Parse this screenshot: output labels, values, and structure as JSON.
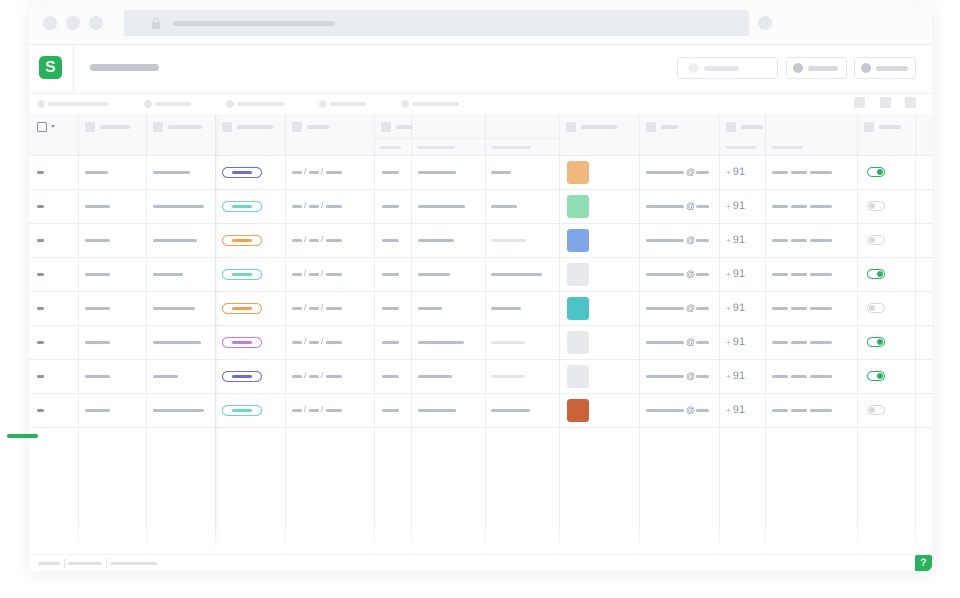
{
  "app": {
    "logo_glyph": "S",
    "logo_color": "#27b35c",
    "accent": "#27b35c"
  },
  "footer": {
    "help_label": "?"
  },
  "rows": [
    {
      "pill_color": "#6b6fd0",
      "swatch": "#f0b87c",
      "phone_prefix": "+",
      "phone_code": "91",
      "at": "@",
      "toggle": true,
      "link_light": false
    },
    {
      "pill_color": "#6fd6c4",
      "swatch": "#8fddb0",
      "phone_prefix": "+",
      "phone_code": "91",
      "at": "@",
      "toggle": false,
      "link_light": false
    },
    {
      "pill_color": "#f0a24e",
      "swatch": "#7fa6e8",
      "phone_prefix": "+",
      "phone_code": "91",
      "at": "@",
      "toggle": false,
      "link_light": true
    },
    {
      "pill_color": "#6fd6c4",
      "swatch": "#e7e9ed",
      "phone_prefix": "+",
      "phone_code": "91",
      "at": "@",
      "toggle": true,
      "link_light": false
    },
    {
      "pill_color": "#f0a24e",
      "swatch": "#4cc4c6",
      "phone_prefix": "+",
      "phone_code": "91",
      "at": "@",
      "toggle": false,
      "link_light": false
    },
    {
      "pill_color": "#c77ae0",
      "swatch": "#e7e9ed",
      "phone_prefix": "+",
      "phone_code": "91",
      "at": "@",
      "toggle": true,
      "link_light": true
    },
    {
      "pill_color": "#6b6fd0",
      "swatch": "#e7e9ed",
      "phone_prefix": "+",
      "phone_code": "91",
      "at": "@",
      "toggle": true,
      "link_light": true
    },
    {
      "pill_color": "#6fd6c4",
      "swatch": "#cc6238",
      "phone_prefix": "+",
      "phone_code": "91",
      "at": "@",
      "toggle": false,
      "link_light": false
    }
  ],
  "icons": {
    "lock": "lock-icon",
    "checkbox": "checkbox-icon",
    "chevron": "chevron-down-icon",
    "help": "help-icon"
  }
}
